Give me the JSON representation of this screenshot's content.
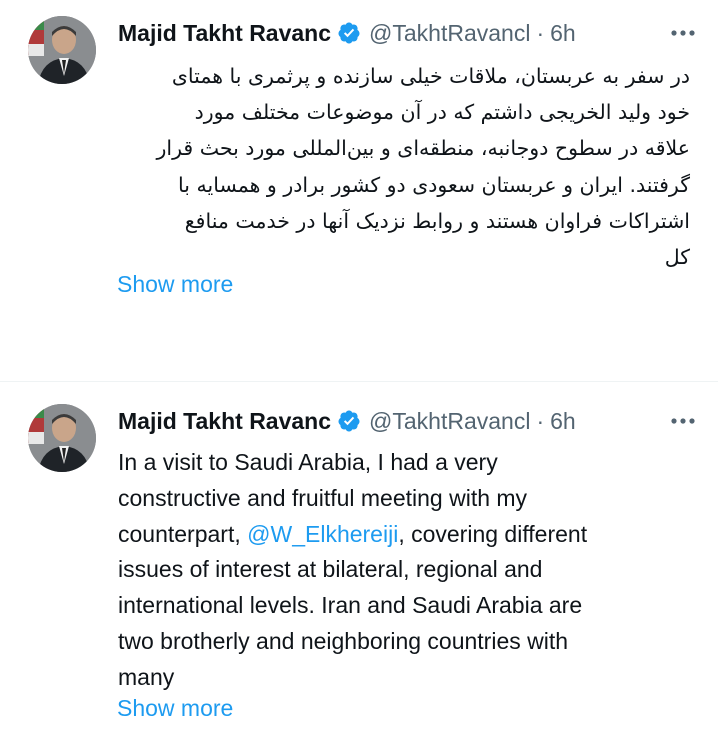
{
  "tweets": [
    {
      "author_name": "Majid Takht Ravanc",
      "handle": "@TakhtRavancl",
      "separator": "·",
      "time": "6h",
      "more_label": "···",
      "lines": [
        "در سفر به عربستان، ملاقات خیلی سازنده و پرثمری با همتای",
        "خود ولید الخریجی داشتم که در آن موضوعات مختلف مورد",
        "علاقه در سطوح دوجانبه، منطقه‌ای و بین‌المللی مورد بحث قرار",
        "گرفتند. ایران و عربستان سعودی دو کشور برادر و همسایه با",
        "اشتراکات فراوان هستند و روابط نزدیک آنها در خدمت منافع",
        "کل"
      ],
      "show_more": "Show more"
    },
    {
      "author_name": "Majid Takht Ravanc",
      "handle": "@TakhtRavancl",
      "separator": "·",
      "time": "6h",
      "more_label": "···",
      "lines": {
        "l1": "In a visit to Saudi Arabia, I had a very",
        "l2": "constructive and fruitful meeting with my",
        "l3_before": "counterpart, ",
        "l3_mention": "@W_Elkhereiji",
        "l3_after": ", covering different",
        "l4": "issues of interest at bilateral, regional and",
        "l5": "international levels. Iran and Saudi Arabia are",
        "l6": "two brotherly and neighboring countries with",
        "l7": "many"
      },
      "show_more": "Show more"
    }
  ],
  "colors": {
    "text": "#0f1419",
    "secondary": "#536471",
    "link": "#1d9bf0",
    "verified": "#1d9bf0",
    "divider": "#eff3f4"
  },
  "icons": {
    "verified": "verified-badge-icon",
    "more": "more-dots-icon",
    "avatar": "profile-photo"
  }
}
